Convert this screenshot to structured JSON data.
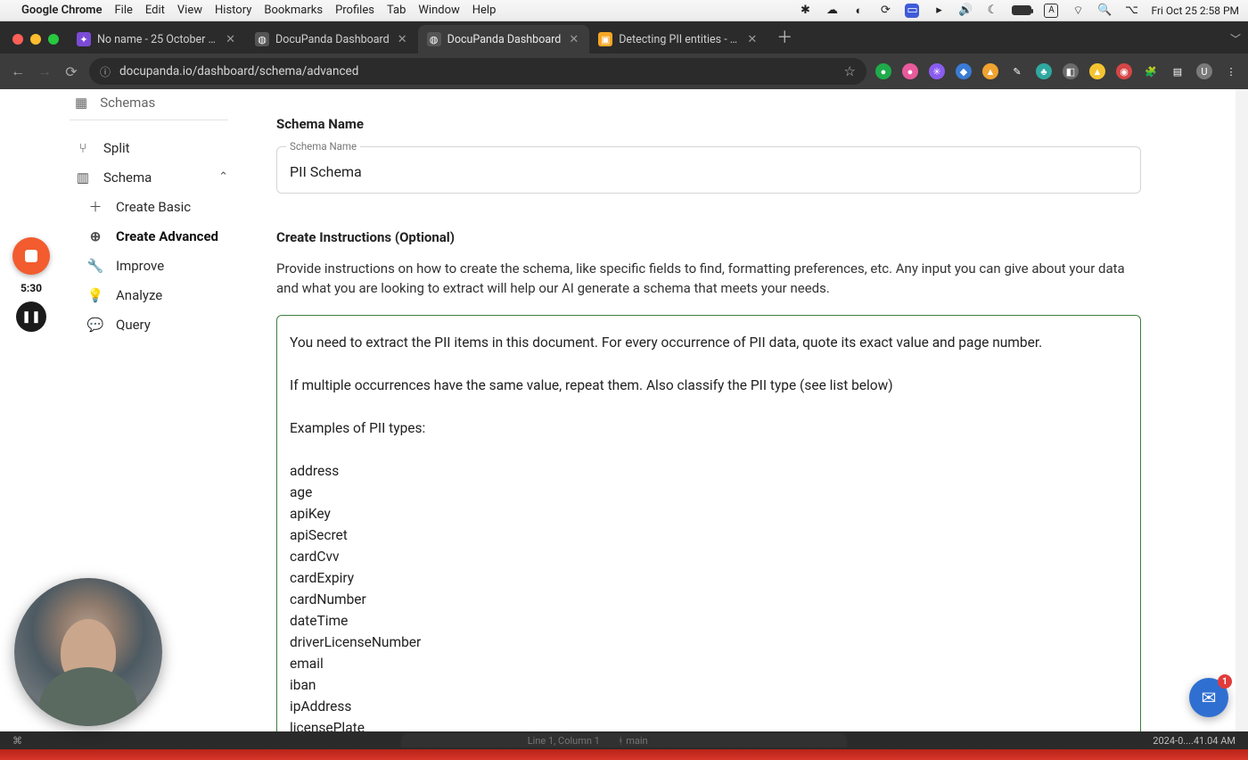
{
  "menubar": {
    "app": "Google Chrome",
    "items": [
      "File",
      "Edit",
      "View",
      "History",
      "Bookmarks",
      "Profiles",
      "Tab",
      "Window",
      "Help"
    ],
    "datetime": "Fri Oct 25  2:58 PM"
  },
  "tabs": [
    {
      "title": "No name - 25 October 2024",
      "favicon": "fav-purple",
      "active": false
    },
    {
      "title": "DocuPanda Dashboard",
      "favicon": "fav-gray",
      "active": false
    },
    {
      "title": "DocuPanda Dashboard",
      "favicon": "fav-gray",
      "active": true
    },
    {
      "title": "Detecting PII entities - Amaz…",
      "favicon": "fav-orange",
      "active": false
    }
  ],
  "url": "docupanda.io/dashboard/schema/advanced",
  "sidebar": {
    "schemas_label": "Schemas",
    "split": "Split",
    "schema": "Schema",
    "create_basic": "Create Basic",
    "create_advanced": "Create Advanced",
    "improve": "Improve",
    "analyze": "Analyze",
    "query": "Query"
  },
  "form": {
    "name_section": "Schema Name",
    "name_float": "Schema Name",
    "name_value": "PII Schema",
    "instr_section": "Create Instructions (Optional)",
    "instr_desc": "Provide instructions on how to create the schema, like specific fields to find, formatting preferences, etc. Any input you can give about your data and what you are looking to extract will help our AI generate a schema that meets your needs.",
    "instructions": "You need to extract the PII items in this document. For every occurrence of PII data, quote its exact value and page number.\n\nIf multiple occurrences have the same value, repeat them. Also classify the PII type (see list below)\n\nExamples of PII types:\n\naddress\nage\napiKey\napiSecret\ncardCvv\ncardExpiry\ncardNumber\ndateTime\ndriverLicenseNumber\nemail\niban\nipAddress\nlicensePlate\nmacAddress\nfullName\npassword\nphoneNumber\npinCode\nswiftCode\nurl\nusername\nvehicleIdNumber\nhealthServiceNumber\nsocialInsuranceNumber\naadhaarNumber"
  },
  "recorder": {
    "time": "5:30"
  },
  "chat": {
    "badge": "1"
  },
  "status": {
    "line": "Line 1, Column 1",
    "branch": "main",
    "clock": "2024-0....41.04 AM"
  }
}
